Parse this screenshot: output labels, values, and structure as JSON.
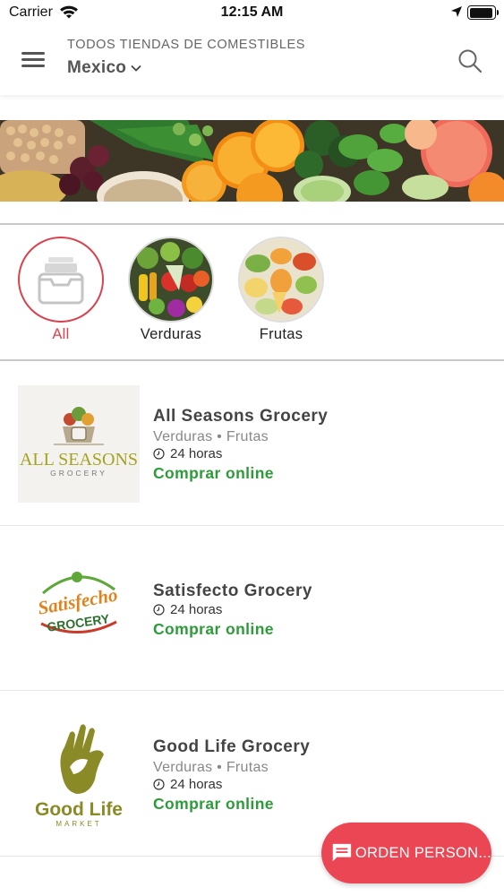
{
  "status_bar": {
    "carrier": "Carrier",
    "time": "12:15 AM"
  },
  "header": {
    "subtitle": "TODOS TIENDAS DE COMESTIBLES",
    "location": "Mexico"
  },
  "categories": [
    {
      "label": "All",
      "selected": true
    },
    {
      "label": "Verduras",
      "selected": false
    },
    {
      "label": "Frutas",
      "selected": false
    }
  ],
  "stores": [
    {
      "name": "All Seasons Grocery",
      "tags": "Verduras • Frutas",
      "hours": "24 horas",
      "cta": "Comprar online",
      "logo_text": "ALL SEASONS",
      "logo_subtext": "GROCERY"
    },
    {
      "name": "Satisfecto Grocery",
      "hours": "24 horas",
      "cta": "Comprar online",
      "logo_text": "Satisfecho",
      "logo_subtext": "GROCERY"
    },
    {
      "name": "Good Life Grocery",
      "tags": "Verduras • Frutas",
      "hours": "24 horas",
      "cta": "Comprar online",
      "logo_text": "Good Life",
      "logo_subtext": "MARKET"
    }
  ],
  "fab": {
    "label": "ORDEN PERSON..."
  },
  "colors": {
    "accent": "#ea4654",
    "cta_green": "#2e9b3a",
    "selected_category": "#d9434f"
  }
}
